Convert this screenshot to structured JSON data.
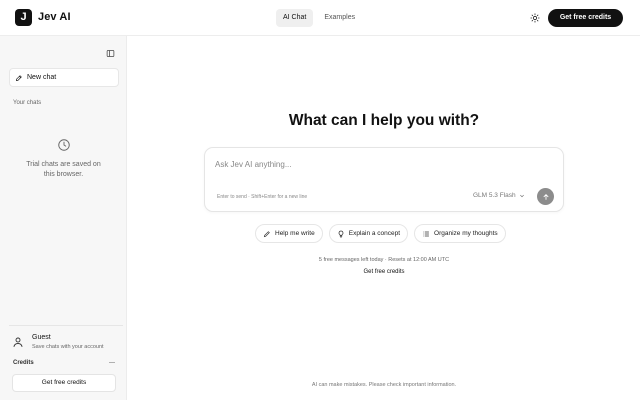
{
  "app": {
    "logo_letter": "J",
    "brand": "Jev AI"
  },
  "header": {
    "tabs": [
      {
        "label": "AI Chat",
        "active": true
      },
      {
        "label": "Examples",
        "active": false
      }
    ],
    "cta_label": "Get free credits",
    "theme_icon": "sun-icon"
  },
  "sidebar": {
    "collapse_icon": "sidebar-toggle-icon",
    "new_chat_label": "New chat",
    "section_label": "Your chats",
    "empty_text": "Trial chats are saved on this browser.",
    "guest_name": "Guest",
    "guest_sub": "Save chats with your account",
    "credits_label": "Credits",
    "credits_value": "—",
    "cta_label": "Get free credits"
  },
  "main": {
    "title": "What can I help you with?",
    "composer": {
      "placeholder": "Ask Jev AI anything...",
      "value": "",
      "hint": "Enter to send · Shift+Enter for a new line",
      "model": "GLM 5.3 Flash"
    },
    "chips": [
      {
        "label": "Help me write",
        "icon": "pen-icon"
      },
      {
        "label": "Explain a concept",
        "icon": "lightbulb-icon"
      },
      {
        "label": "Organize my thoughts",
        "icon": "list-icon"
      }
    ],
    "limits_text": "5 free messages left today · Resets at 12:00 AM UTC",
    "limits_cta": "Get free credits",
    "disclaimer": "AI can make mistakes. Please check important information."
  },
  "colors": {
    "primary": "#111111",
    "sidebar_bg": "#f7f7f7",
    "send_disabled": "#8c8c8c"
  }
}
